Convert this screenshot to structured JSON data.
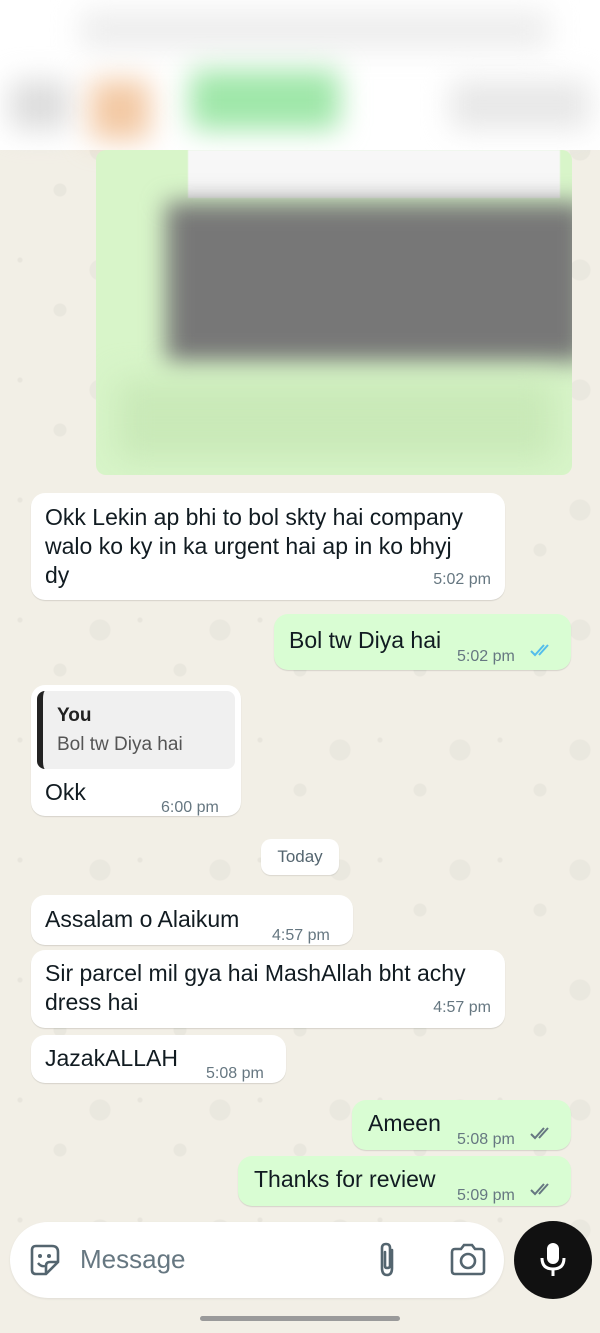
{
  "messages": [
    {
      "id": "m1",
      "dir": "in",
      "text_lines": [
        "Okk Lekin ap bhi to bol skty hai company",
        "walo ko ky in ka urgent hai ap in ko bhyj",
        "dy"
      ],
      "time": "5:02 pm"
    },
    {
      "id": "m2",
      "dir": "out",
      "text": "Bol tw Diya hai",
      "time": "5:02 pm",
      "status": "read"
    },
    {
      "id": "m3",
      "dir": "in",
      "quote_author": "You",
      "quote_text": "Bol tw Diya hai",
      "text": "Okk",
      "time": "6:00 pm"
    },
    {
      "id": "m4",
      "dir": "in",
      "text": "Assalam o Alaikum",
      "time": "4:57 pm"
    },
    {
      "id": "m5",
      "dir": "in",
      "text_lines": [
        "Sir parcel mil gya hai MashAllah bht achy",
        "dress hai"
      ],
      "time": "4:57 pm"
    },
    {
      "id": "m6",
      "dir": "in",
      "text": "JazakALLAH",
      "time": "5:08 pm"
    },
    {
      "id": "m7",
      "dir": "out",
      "text": "Ameen",
      "time": "5:08 pm",
      "status": "delivered"
    },
    {
      "id": "m8",
      "dir": "out",
      "text": "Thanks for review",
      "time": "5:09 pm",
      "status": "delivered"
    }
  ],
  "day_separator": "Today",
  "composer": {
    "placeholder": "Message",
    "icons": {
      "emoji": "sticker-smile-icon",
      "attach": "paperclip-icon",
      "camera": "camera-icon",
      "mic": "microphone-icon"
    }
  },
  "colors": {
    "incoming_bubble": "#ffffff",
    "outgoing_bubble": "#d9fdd3",
    "read_tick": "#53bdeb",
    "sent_tick": "#667781",
    "chat_background": "#f2efe6"
  }
}
